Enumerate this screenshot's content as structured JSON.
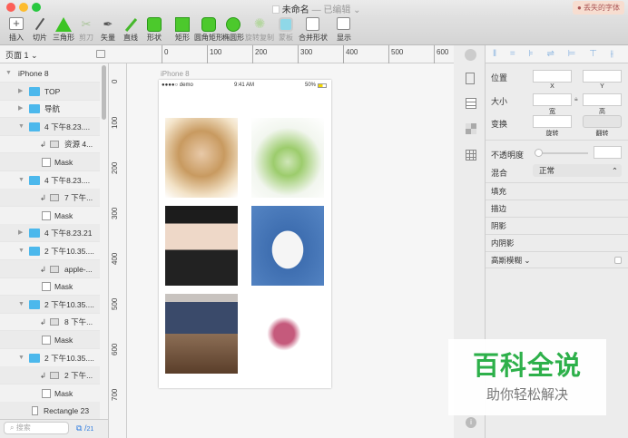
{
  "window": {
    "title": "未命名",
    "status": "— 已编辑 ⌄",
    "missing_fonts": "丢失的字体"
  },
  "toolbar": [
    {
      "id": "insert",
      "label": "插入"
    },
    {
      "id": "slice",
      "label": "切片"
    },
    {
      "id": "triangle",
      "label": "三角形"
    },
    {
      "id": "scissors",
      "label": "剪刀"
    },
    {
      "id": "vector",
      "label": "矢量"
    },
    {
      "id": "line",
      "label": "直线"
    },
    {
      "id": "shape",
      "label": "形状"
    },
    {
      "id": "rectangle",
      "label": "矩形"
    },
    {
      "id": "rounded-rect",
      "label": "圆角矩形"
    },
    {
      "id": "oval",
      "label": "椭圆形"
    },
    {
      "id": "rotate-copy",
      "label": "旋转复制"
    },
    {
      "id": "mask",
      "label": "蒙板"
    },
    {
      "id": "combine",
      "label": "合并形状"
    },
    {
      "id": "view",
      "label": "显示"
    }
  ],
  "sidebar": {
    "page": "页面 1 ⌄",
    "layers": [
      {
        "label": "iPhone 8",
        "type": "artboard",
        "indent": 0
      },
      {
        "label": "TOP",
        "type": "folder",
        "indent": 1,
        "open": false
      },
      {
        "label": "导航",
        "type": "folder",
        "indent": 1,
        "open": false
      },
      {
        "label": "4 下午8.23....",
        "type": "folder",
        "indent": 1,
        "open": true
      },
      {
        "label": "资源 4...",
        "type": "image",
        "indent": 2
      },
      {
        "label": "Mask",
        "type": "mask",
        "indent": 2
      },
      {
        "label": "4 下午8.23....",
        "type": "folder",
        "indent": 1,
        "open": true
      },
      {
        "label": "7 下午...",
        "type": "image",
        "indent": 2
      },
      {
        "label": "Mask",
        "type": "mask",
        "indent": 2
      },
      {
        "label": "4 下午8.23.21",
        "type": "folder",
        "indent": 1,
        "open": false
      },
      {
        "label": "2 下午10.35....",
        "type": "folder",
        "indent": 1,
        "open": true
      },
      {
        "label": "apple-...",
        "type": "image",
        "indent": 2
      },
      {
        "label": "Mask",
        "type": "mask",
        "indent": 2
      },
      {
        "label": "2 下午10.35....",
        "type": "folder",
        "indent": 1,
        "open": true
      },
      {
        "label": "8 下午...",
        "type": "image",
        "indent": 2
      },
      {
        "label": "Mask",
        "type": "mask",
        "indent": 2
      },
      {
        "label": "2 下午10.35....",
        "type": "folder",
        "indent": 1,
        "open": true
      },
      {
        "label": "2 下午...",
        "type": "image",
        "indent": 2
      },
      {
        "label": "Mask",
        "type": "mask",
        "indent": 2
      },
      {
        "label": "Rectangle 23",
        "type": "rect",
        "indent": 1
      }
    ],
    "search_placeholder": "搜索",
    "count": "21"
  },
  "rulers": {
    "h": [
      "0",
      "100",
      "200",
      "300",
      "400",
      "500",
      "600"
    ],
    "v": [
      "0",
      "100",
      "200",
      "300",
      "400",
      "500",
      "600",
      "700"
    ]
  },
  "artboard": {
    "name": "iPhone 8",
    "carrier": "●●●●○ demo",
    "time": "9:41 AM",
    "battery": "50%"
  },
  "inspector": {
    "position": "位置",
    "x": "X",
    "y": "Y",
    "size": "大小",
    "w": "宽",
    "h": "高",
    "transform": "变换",
    "rotate": "旋转",
    "flip": "翻转",
    "opacity": "不透明度",
    "opacity_value": 0,
    "blend": "混合",
    "blend_value": "正常",
    "sections": [
      "填充",
      "描边",
      "阴影",
      "内阴影",
      "高斯模糊 ⌄"
    ]
  },
  "watermark": {
    "line1": "百科全说",
    "line2": "助你轻松解决"
  }
}
